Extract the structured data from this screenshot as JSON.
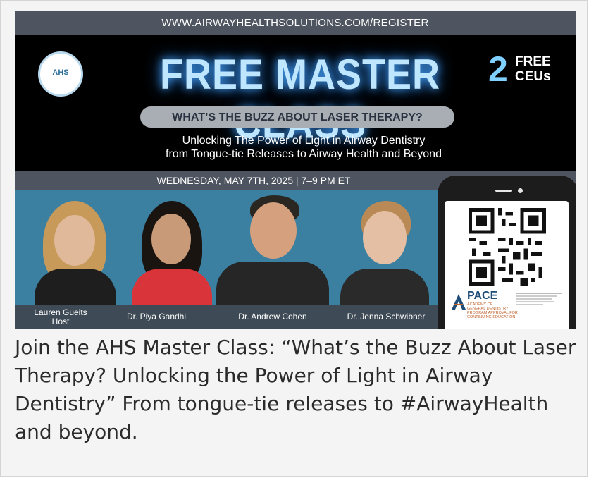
{
  "banner": {
    "url": "WWW.AIRWAYHEALTHSOLUTIONS.COM/REGISTER",
    "logo_text": "AHS",
    "title": "FREE MASTER CLASS",
    "ceu_number": "2",
    "ceu_line1": "FREE",
    "ceu_line2": "CEUs",
    "subtitle": "WHAT’S THE BUZZ ABOUT LASER THERAPY?",
    "tagline_line1": "Unlocking The Power of Light in Airway Dentistry",
    "tagline_line2": "from Tongue-tie Releases to Airway Health and Beyond",
    "date": "WEDNESDAY, MAY 7TH, 2025 | 7–9 PM ET",
    "speakers": [
      {
        "name": "Lauren Gueits",
        "role": "Host"
      },
      {
        "name": "Dr. Piya Gandhi",
        "role": ""
      },
      {
        "name": "Dr. Andrew Cohen",
        "role": ""
      },
      {
        "name": "Dr. Jenna Schwibner",
        "role": ""
      }
    ],
    "pace": {
      "title": "PACE",
      "subtitle_line1": "ACADEMY OF",
      "subtitle_line2": "GENERAL DENTISTRY",
      "subtitle_line3": "PROGRAM APPROVAL FOR",
      "subtitle_line4": "CONTINUING EDUCATION"
    }
  },
  "caption": "Join the AHS Master Class: “What’s the Buzz About Laser Therapy? Unlocking the Power of Light in Airway Dentistry” From tongue-tie releases to #AirwayHealth and beyond.",
  "colors": {
    "url_bar": "#4f5560",
    "title_glow": "#4aa7ff",
    "ceu_accent": "#7fd0ff",
    "speaker_bg": "#3b7fa1",
    "pill": "#a9adb4"
  }
}
